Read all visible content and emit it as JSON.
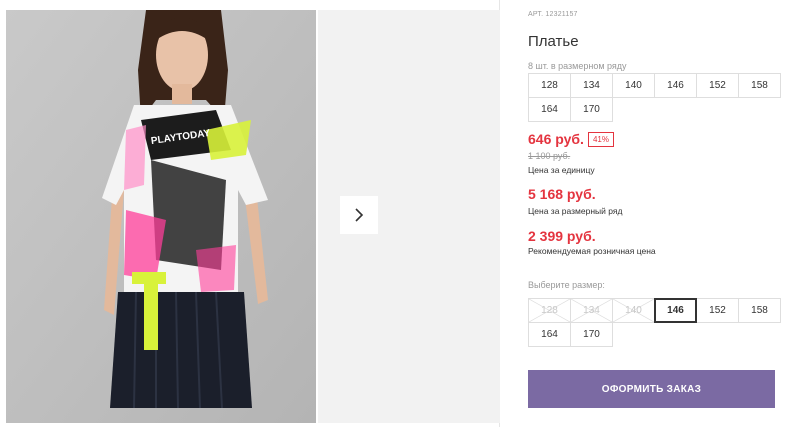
{
  "product": {
    "article": "АРТ. 12321157",
    "title": "Платье",
    "size_count_note": "8 шт. в размерном ряду",
    "range_sizes": [
      "128",
      "134",
      "140",
      "146",
      "152",
      "158",
      "164",
      "170"
    ]
  },
  "gallery": {
    "next_icon": "chevron-right-icon",
    "shirt_print": "PLAYTODAY"
  },
  "pricing": {
    "unit_price": "646 руб.",
    "discount": "41%",
    "old_price": "1 100 руб.",
    "unit_label": "Цена за единицу",
    "row_price": "5 168 руб.",
    "row_label": "Цена за размерный ряд",
    "retail_price": "2 399 руб.",
    "retail_label": "Рекомендуемая розничная цена",
    "accent_color": "#e4343f"
  },
  "size_select": {
    "label": "Выберите размер:",
    "options": [
      {
        "size": "128",
        "available": false,
        "selected": false
      },
      {
        "size": "134",
        "available": false,
        "selected": false
      },
      {
        "size": "140",
        "available": false,
        "selected": false
      },
      {
        "size": "146",
        "available": true,
        "selected": true
      },
      {
        "size": "152",
        "available": true,
        "selected": false
      },
      {
        "size": "158",
        "available": true,
        "selected": false
      },
      {
        "size": "164",
        "available": true,
        "selected": false
      },
      {
        "size": "170",
        "available": true,
        "selected": false
      }
    ]
  },
  "order_button": {
    "label": "ОФОРМИТЬ ЗАКАЗ",
    "color": "#7b6aa3"
  }
}
